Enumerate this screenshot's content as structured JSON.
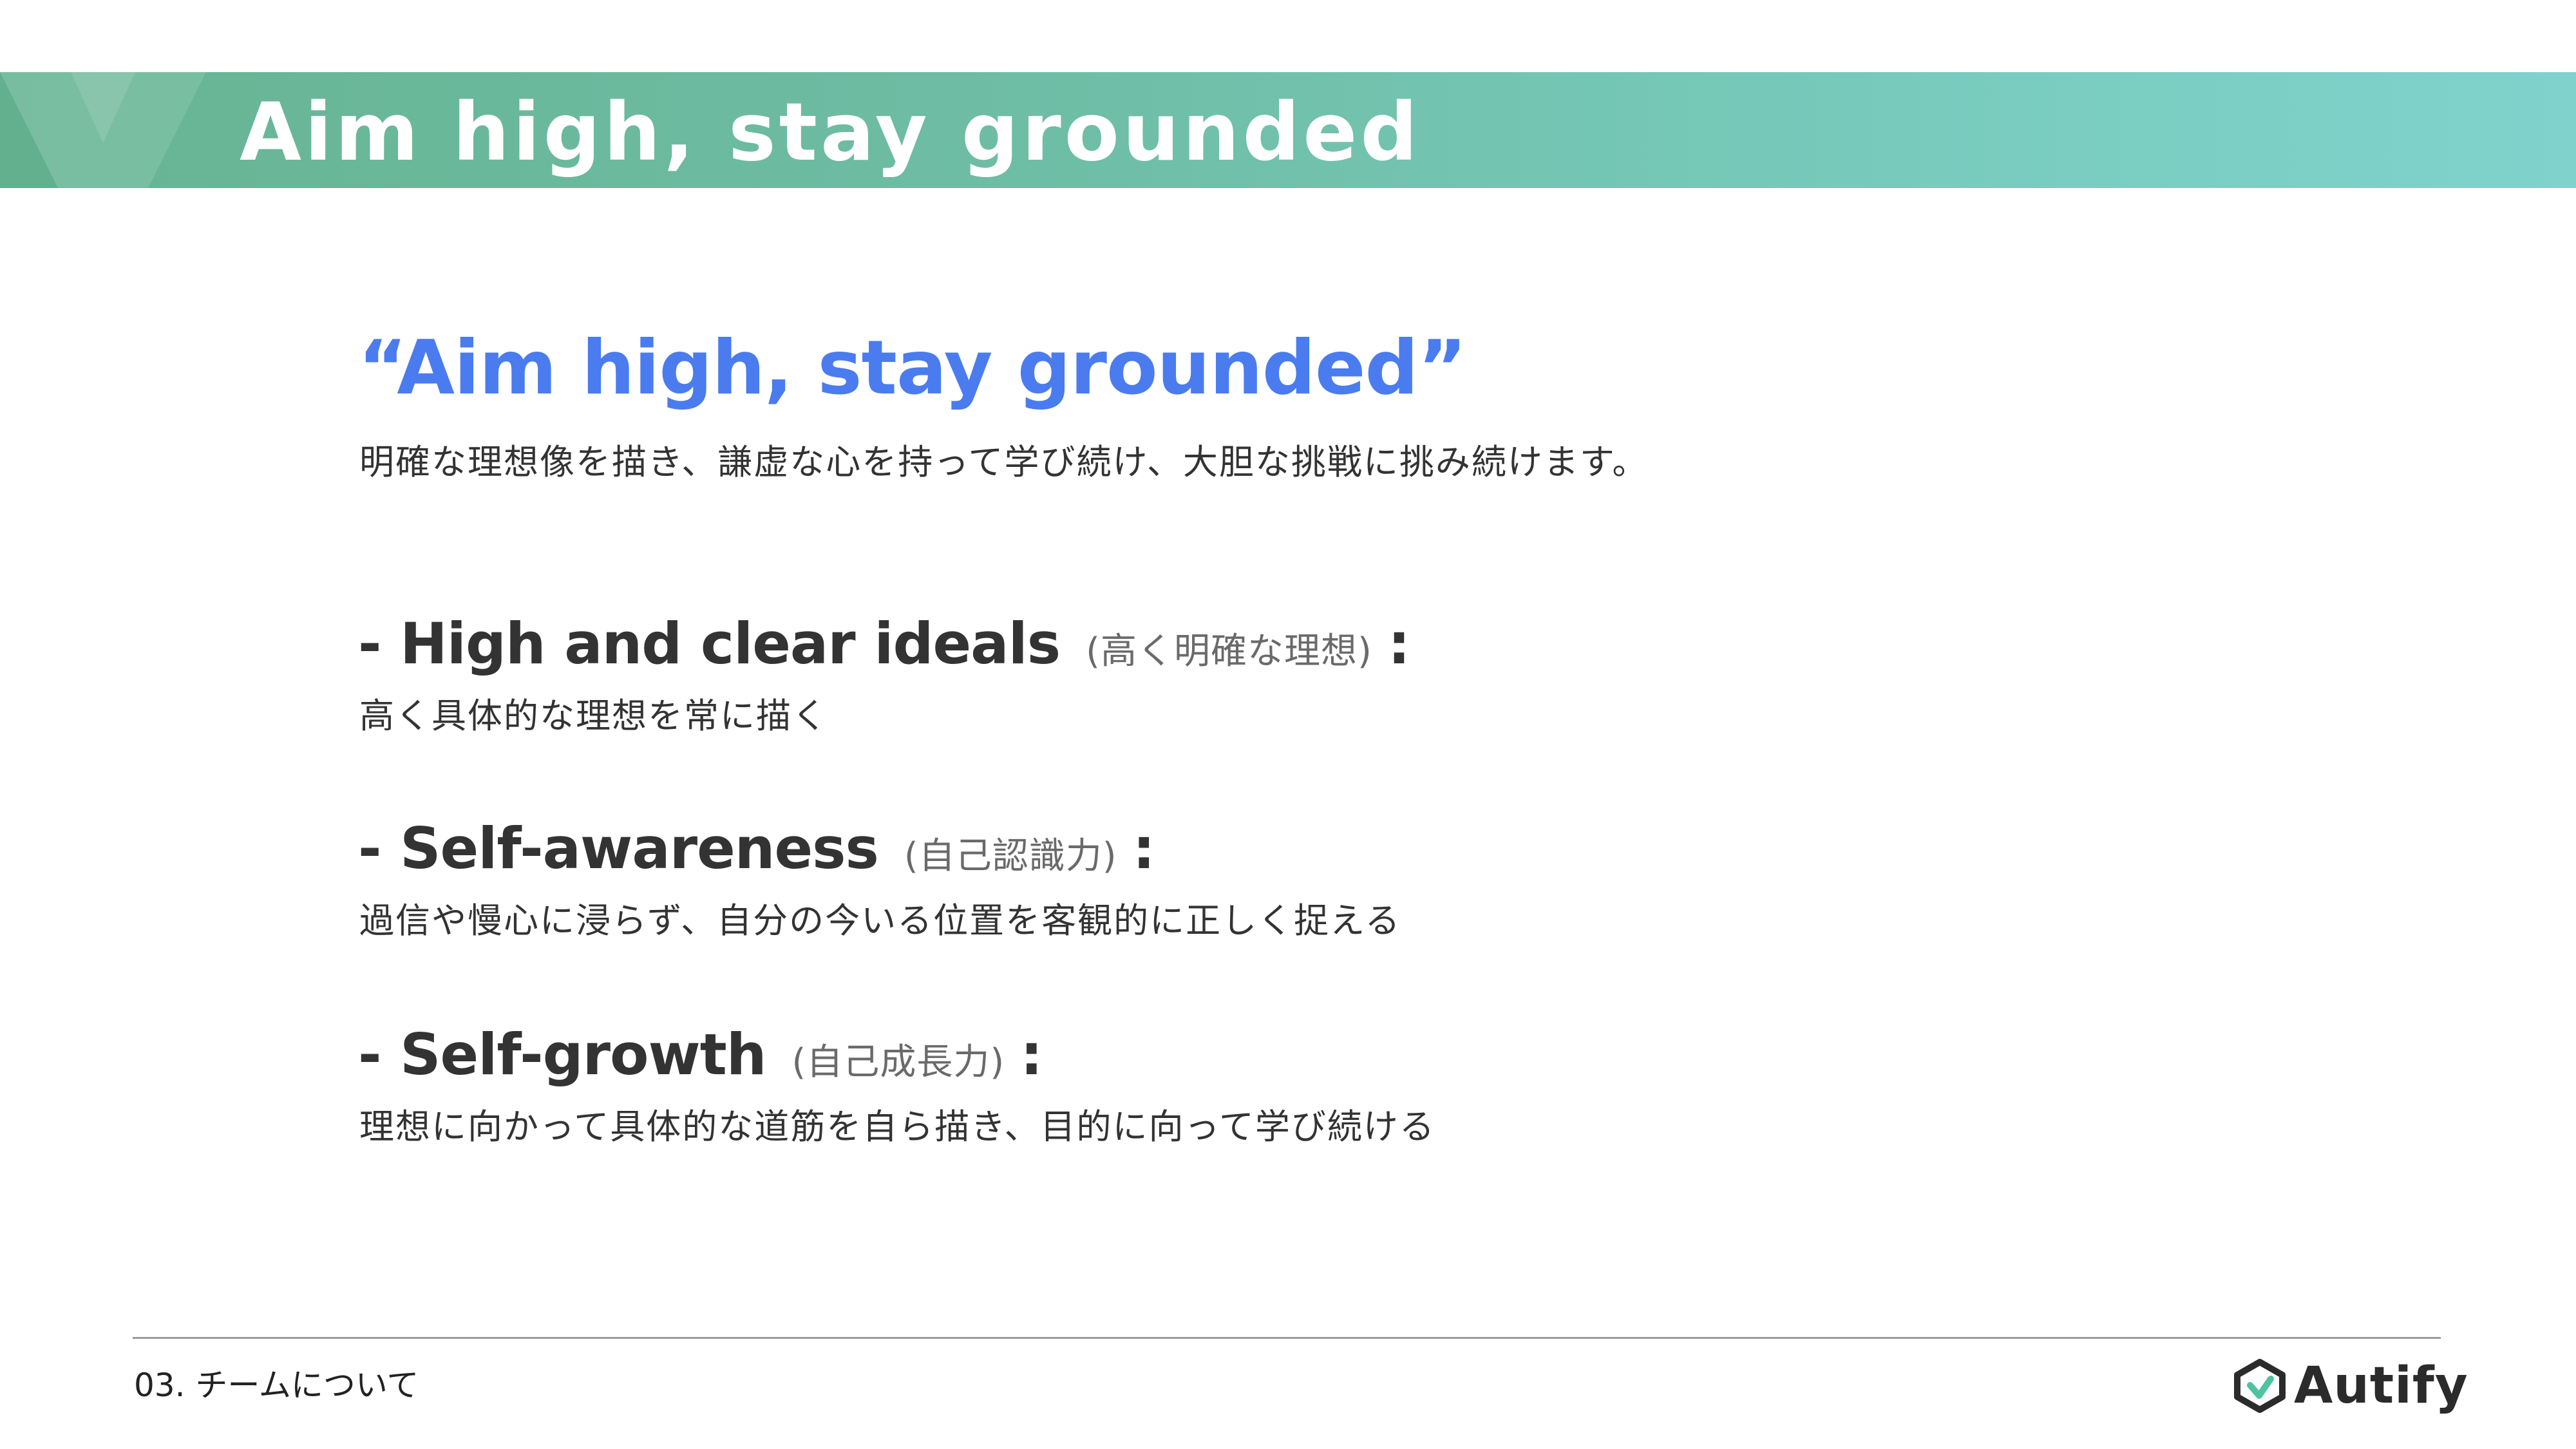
{
  "header": {
    "title": "Aim high, stay grounded"
  },
  "quote": {
    "text": "“Aim high, stay grounded”",
    "description": "明確な理想像を描き、謙虚な心を持って学び続け、大胆な挑戦に挑み続けます。"
  },
  "items": [
    {
      "title": "- High and clear ideals",
      "subtitle": "(高く明確な理想)",
      "colon": ":",
      "description": "高く具体的な理想を常に描く"
    },
    {
      "title": "- Self-awareness",
      "subtitle": "(自己認識力)",
      "colon": ":",
      "description": "過信や慢心に浸らず、自分の今いる位置を客観的に正しく捉える"
    },
    {
      "title": "- Self-growth",
      "subtitle": "(自己成長力)",
      "colon": ":",
      "description": "理想に向かって具体的な道筋を自ら描き、目的に向って学び続ける"
    }
  ],
  "footer": {
    "section": "03. チームについて",
    "logo_text": "Autify"
  },
  "colors": {
    "accent_blue": "#4a7cf0",
    "header_green_start": "#67b493",
    "header_teal_end": "#7fd3cc",
    "text_dark": "#333333"
  },
  "icons": {
    "logo": "autify-logo-icon",
    "header_decoration": "chevron-decoration"
  }
}
